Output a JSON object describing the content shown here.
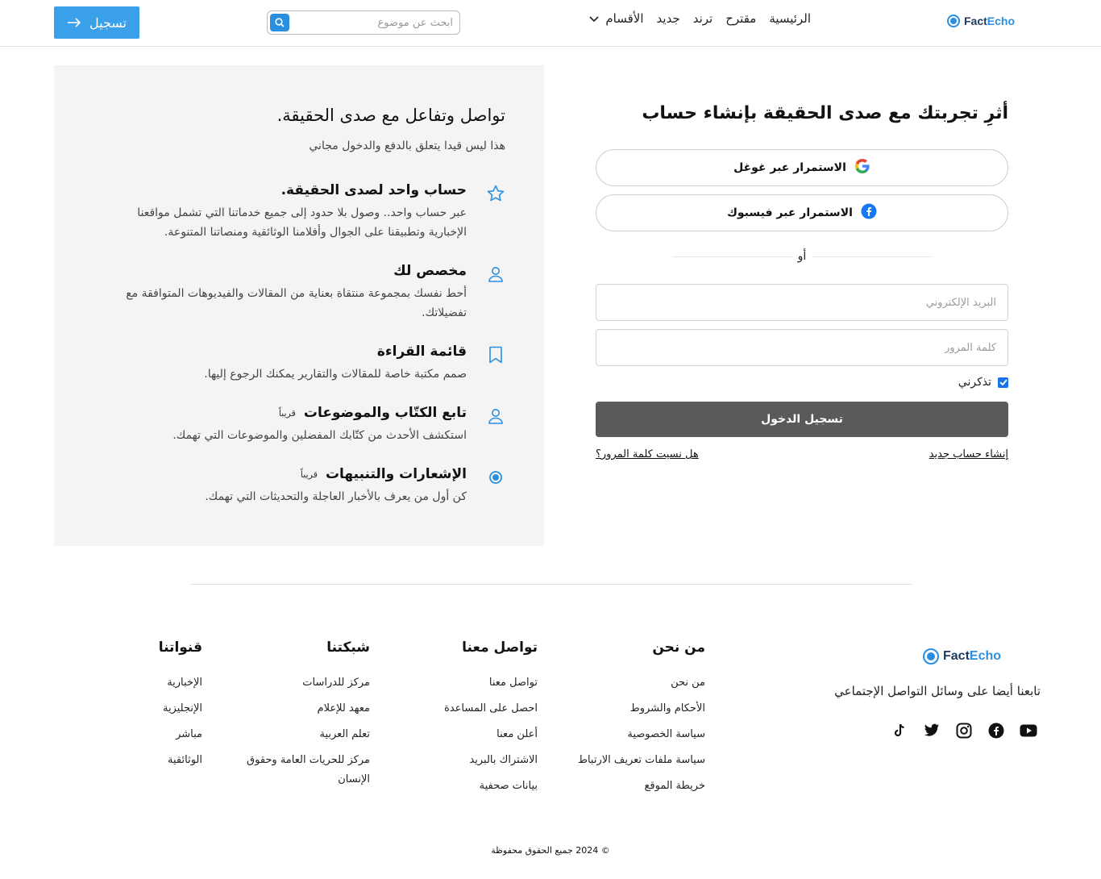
{
  "header": {
    "logo": {
      "fact": "Fact",
      "echo": "Echo"
    },
    "nav": [
      "الرئيسية",
      "مقترح",
      "ترند",
      "جديد",
      "الأقسام"
    ],
    "search_placeholder": "ابحث عن موضوع",
    "register_label": "تسجيل"
  },
  "login": {
    "title": "أثرِ تجربتك مع صدى الحقيقة بإنشاء حساب",
    "google_label": "الاستمرار عبر غوغل",
    "facebook_label": "الاستمرار عبر فيسبوك",
    "or_label": "أو",
    "email_placeholder": "البريد الإلكتروني",
    "password_placeholder": "كلمة المرور",
    "remember_label": "تذكرني",
    "remember_checked": true,
    "submit_label": "تسجيل الدخول",
    "create_account_label": "إنشاء حساب جديد",
    "forgot_password_label": "هل نسيت كلمة المرور؟"
  },
  "benefits": {
    "title": "تواصل وتفاعل مع صدى الحقيقة.",
    "subtitle": "هذا ليس قيدا يتعلق بالدفع والدخول مجاني",
    "items": [
      {
        "title": "حساب واحد لصدى الحقيقة.",
        "desc": "عبر حساب واحد.. وصول بلا حدود إلى جميع خدماتنا التي تشمل مواقعنا الإخبارية وتطبيقنا على الجوال وأفلامنا الوثائقية ومنصاتنا المتنوعة.",
        "icon": "star-icon"
      },
      {
        "title": "مخصص لك",
        "desc": "أحط نفسك بمجموعة منتقاة بعناية من المقالات والفيديوهات المتوافقة مع تفضيلاتك.",
        "icon": "user-icon"
      },
      {
        "title": "قائمة القراءة",
        "desc": "صمم مكتبة خاصة للمقالات والتقارير يمكنك الرجوع إليها.",
        "icon": "bookmark-icon"
      },
      {
        "title": "تابع الكتّاب والموضوعات",
        "soon": "قريباً",
        "desc": "استكشف الأحدث من كتّابك المفضلين والموضوعات التي تهمك.",
        "icon": "user-icon"
      },
      {
        "title": "الإشعارات والتنبيهات",
        "soon": "قريباً",
        "desc": "كن أول من يعرف بالأخبار العاجلة والتحديثات التي تهمك.",
        "icon": "notification-dot-icon"
      }
    ]
  },
  "footer": {
    "follow_text": "تابعنا أيضا على وسائل التواصل الإجتماعي",
    "columns": [
      {
        "title": "من نحن",
        "links": [
          "من نحن",
          "الأحكام والشروط",
          "سياسة الخصوصية",
          "سياسة ملفات تعريف الارتباط",
          "خريطة الموقع"
        ]
      },
      {
        "title": "تواصل معنا",
        "links": [
          "تواصل معنا",
          "احصل على المساعدة",
          "أعلن معنا",
          "الاشتراك بالبريد",
          "بيانات صحفية"
        ]
      },
      {
        "title": "شبكتنا",
        "links": [
          "مركز للدراسات",
          "معهد للإعلام",
          "تعلم العربية",
          "مركز للحريات العامة وحقوق الإنسان"
        ]
      },
      {
        "title": "قنواتنا",
        "links": [
          "الإخبارية",
          "الإنجليزية",
          "مباشر",
          "الوثائقية"
        ]
      }
    ],
    "socials": [
      "youtube-icon",
      "facebook-icon",
      "instagram-icon",
      "twitter-icon",
      "tiktok-icon"
    ],
    "copyright": "© 2024 جميع الحقوق محفوظة"
  },
  "colors": {
    "accent": "#2b8fe0",
    "button_blue": "#3aa0ea",
    "submit_gray": "#5a5a5a",
    "panel_bg": "#f4f4f4"
  }
}
